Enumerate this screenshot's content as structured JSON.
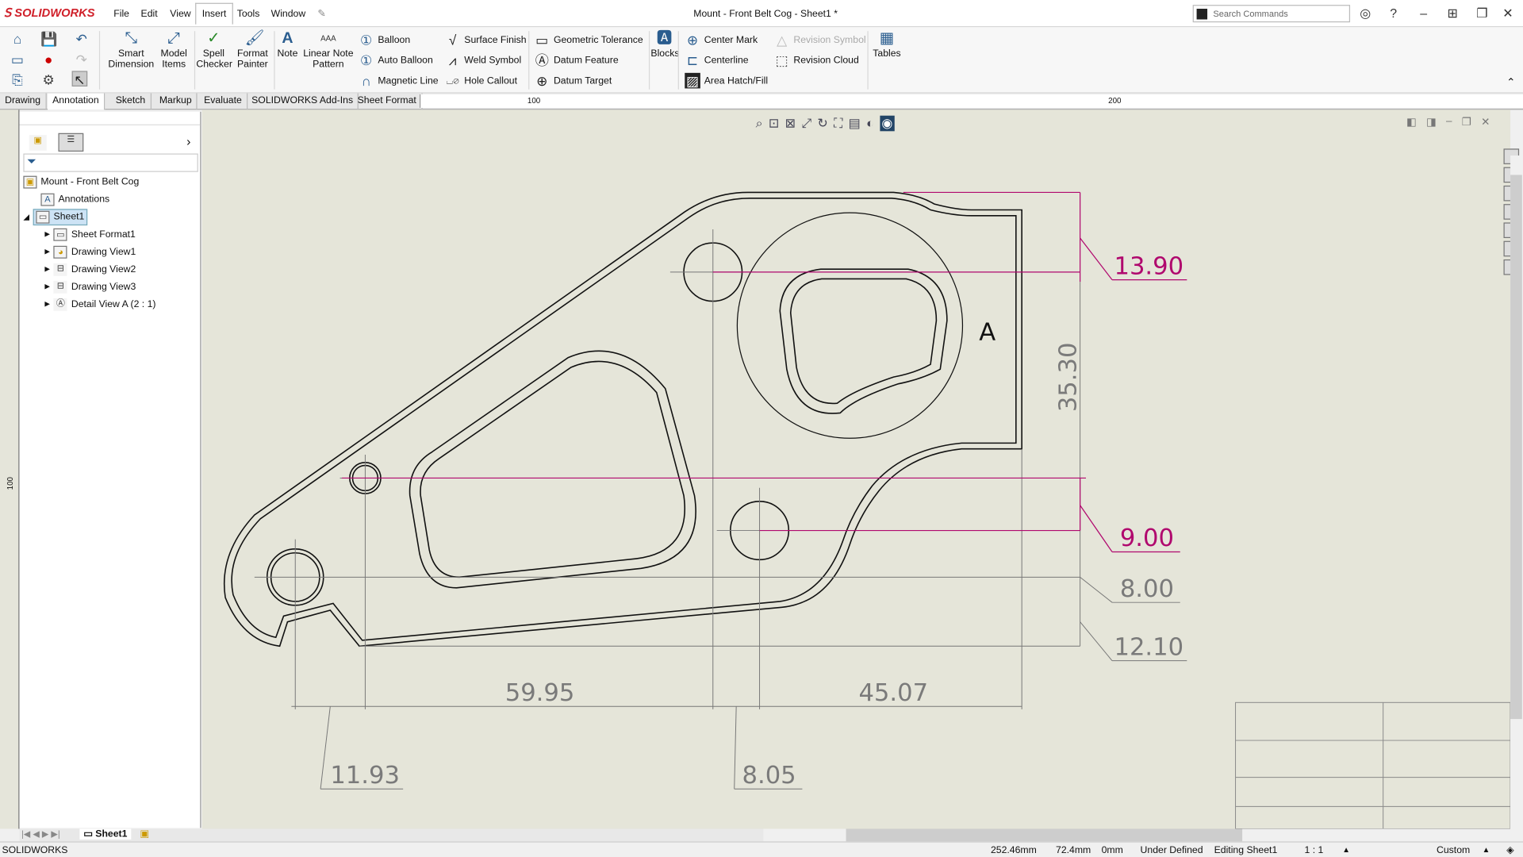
{
  "app": {
    "brand": "SOLIDWORKS",
    "window_title": "Mount - Front Belt Cog - Sheet1 *",
    "search_placeholder": "Search Commands"
  },
  "menus": [
    "File",
    "Edit",
    "View",
    "Insert",
    "Tools",
    "Window"
  ],
  "active_menu": "Insert",
  "ribbon": {
    "big": [
      {
        "label": "Smart Dimension",
        "icon": "smart-dimension-icon"
      },
      {
        "label": "Model Items",
        "icon": "model-items-icon"
      },
      {
        "label": "Spell Checker",
        "icon": "spell-checker-icon"
      },
      {
        "label": "Format Painter",
        "icon": "format-painter-icon"
      },
      {
        "label": "Note",
        "icon": "note-icon"
      },
      {
        "label": "Linear Note Pattern",
        "icon": "linear-note-pattern-icon"
      }
    ],
    "col1": [
      "Balloon",
      "Auto Balloon",
      "Magnetic Line"
    ],
    "col2": [
      "Surface Finish",
      "Weld Symbol",
      "Hole Callout"
    ],
    "col3": [
      "Geometric Tolerance",
      "Datum Feature",
      "Datum Target"
    ],
    "blocks": "Blocks",
    "col4": [
      "Center Mark",
      "Centerline",
      "Area Hatch/Fill"
    ],
    "col5": [
      "Revision Symbol",
      "Revision Cloud"
    ],
    "tables": "Tables"
  },
  "tabs": [
    "Drawing",
    "Annotation",
    "Sketch",
    "Markup",
    "Evaluate",
    "SOLIDWORKS Add-Ins",
    "Sheet Format"
  ],
  "active_tab": "Annotation",
  "ruler_labels": [
    "100",
    "200"
  ],
  "vruler_label": "100",
  "tree": {
    "root": "Mount - Front Belt Cog",
    "items": [
      {
        "label": "Annotations"
      },
      {
        "label": "Sheet1",
        "selected": true
      },
      {
        "label": "Sheet Format1"
      },
      {
        "label": "Drawing View1"
      },
      {
        "label": "Drawing View2"
      },
      {
        "label": "Drawing View3"
      },
      {
        "label": "Detail View A (2 : 1)"
      }
    ]
  },
  "drawing": {
    "detail_label": "A",
    "dimensions": {
      "d1": "13.90",
      "d2": "35.30",
      "d3": "9.00",
      "d4": "8.00",
      "d5": "12.10",
      "d6": "59.95",
      "d7": "45.07",
      "d8": "11.93",
      "d9": "8.05"
    },
    "colors": {
      "selected": "#b0086e",
      "dimension": "#7a7a7a",
      "line": "#111111",
      "background": "#e5e5d9"
    }
  },
  "sheet_tab": "Sheet1",
  "status": {
    "app": "SOLIDWORKS",
    "x": "252.46mm",
    "y": "72.4mm",
    "z": "0mm",
    "state": "Under Defined",
    "editing": "Editing Sheet1",
    "scale": "1 : 1",
    "units": "Custom"
  }
}
